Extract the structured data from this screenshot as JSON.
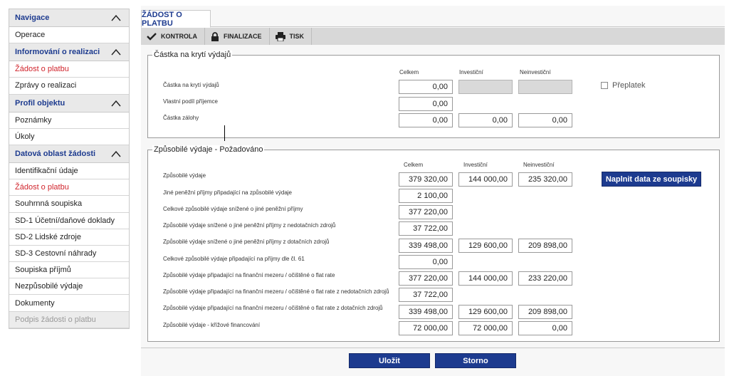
{
  "sidebar": {
    "sections": [
      {
        "title": "Navigace",
        "items": [
          {
            "label": "Operace",
            "state": "normal"
          }
        ]
      },
      {
        "title": "Informování o realizaci",
        "items": [
          {
            "label": "Žádost o platbu",
            "state": "active"
          },
          {
            "label": "Zprávy o realizaci",
            "state": "normal"
          }
        ]
      },
      {
        "title": "Profil objektu",
        "items": [
          {
            "label": "Poznámky",
            "state": "normal"
          },
          {
            "label": "Úkoly",
            "state": "normal"
          }
        ]
      },
      {
        "title": "Datová oblast žádosti",
        "items": [
          {
            "label": "Identifikační údaje",
            "state": "normal"
          },
          {
            "label": "Žádost o platbu",
            "state": "active"
          },
          {
            "label": "Souhrnná soupiska",
            "state": "normal"
          },
          {
            "label": "SD-1 Účetní/daňové doklady",
            "state": "normal"
          },
          {
            "label": "SD-2 Lidské zdroje",
            "state": "normal"
          },
          {
            "label": "SD-3 Cestovní náhrady",
            "state": "normal"
          },
          {
            "label": "Soupiska příjmů",
            "state": "normal"
          },
          {
            "label": "Nezpůsobilé výdaje",
            "state": "normal"
          },
          {
            "label": "Dokumenty",
            "state": "normal"
          },
          {
            "label": "Podpis žádosti o platbu",
            "state": "disabled"
          }
        ]
      }
    ]
  },
  "tab": {
    "label": "ŽÁDOST O PLATBU"
  },
  "toolbar": {
    "kontrola": "KONTROLA",
    "finalizace": "FINALIZACE",
    "tisk": "TISK"
  },
  "colors": {
    "brand": "#1d3b8f",
    "active": "#d0242c",
    "toolbar": "#d8d8d8"
  },
  "coverage": {
    "legend": "Částka na krytí výdajů",
    "col_total": "Celkem",
    "col_invest": "Investiční",
    "col_noninvest": "Neinvestiční",
    "rows": [
      {
        "label": "Částka na krytí výdajů",
        "total": "0,00",
        "invest": "",
        "noninvest": ""
      },
      {
        "label": "Vlastní podíl příjemce",
        "total": "0,00"
      },
      {
        "label": "Částka zálohy",
        "total": "0,00",
        "invest": "0,00",
        "noninvest": "0,00"
      }
    ],
    "overpay_label": "Přeplatek"
  },
  "eligible": {
    "legend": "Způsobilé výdaje - Požadováno",
    "col_total": "Celkem",
    "col_invest": "Investiční",
    "col_noninvest": "Neinvestiční",
    "fill_button": "Naplnit data ze soupisky",
    "rows": [
      {
        "label": "Způsobilé výdaje",
        "total": "379 320,00",
        "invest": "144 000,00",
        "noninvest": "235 320,00"
      },
      {
        "label": "Jiné peněžní příjmy připadající na způsobilé výdaje",
        "total": "2 100,00"
      },
      {
        "label": "Celkové způsobilé výdaje snížené o jiné peněžní příjmy",
        "total": "377 220,00"
      },
      {
        "label": "Způsobilé výdaje snížené o jiné peněžní příjmy z nedotačních zdrojů",
        "total": "37 722,00"
      },
      {
        "label": "Způsobilé výdaje snížené o jiné peněžní příjmy z dotačních zdrojů",
        "total": "339 498,00",
        "invest": "129 600,00",
        "noninvest": "209 898,00"
      },
      {
        "label": "Celkové způsobilé výdaje připadající na příjmy dle čl. 61",
        "total": "0,00"
      },
      {
        "label": "Způsobilé výdaje připadající na finanční mezeru / očištěné o flat rate",
        "total": "377 220,00",
        "invest": "144 000,00",
        "noninvest": "233 220,00"
      },
      {
        "label": "Způsobilé výdaje připadající na finanční mezeru / očištěné o flat rate z nedotačních zdrojů",
        "total": "37 722,00"
      },
      {
        "label": "Způsobilé výdaje připadající na finanční mezeru / očištěné o flat rate z dotačních zdrojů",
        "total": "339 498,00",
        "invest": "129 600,00",
        "noninvest": "209 898,00"
      },
      {
        "label": "Způsobilé výdaje - křížové financování",
        "total": "72 000,00",
        "invest": "72 000,00",
        "noninvest": "0,00"
      }
    ]
  },
  "footer": {
    "save": "Uložit",
    "cancel": "Storno"
  }
}
